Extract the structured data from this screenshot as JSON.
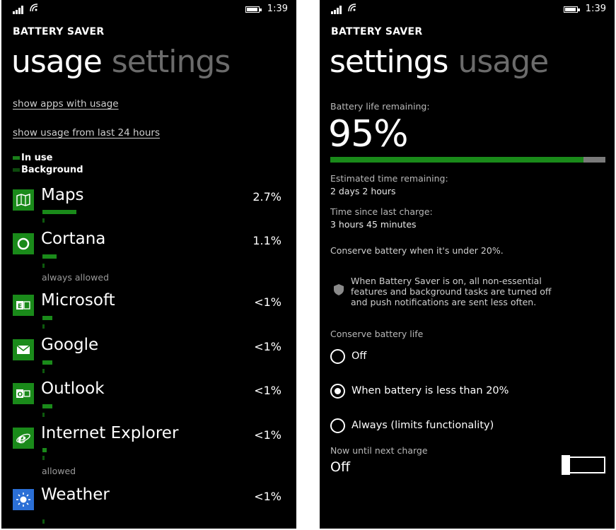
{
  "status": {
    "time": "1:39"
  },
  "left": {
    "app_title": "BATTERY SAVER",
    "pivot": {
      "active": "usage",
      "inactive": "settings"
    },
    "link_apps": "show apps with usage",
    "link_hours": "show usage from last 24 hours",
    "legend": {
      "in_use": "In use",
      "background": "Background"
    },
    "apps": [
      {
        "name": "Maps",
        "pct": "2.7%",
        "icon": "maps-icon",
        "note": "",
        "inuse_fraction": 0.12
      },
      {
        "name": "Cortana",
        "pct": "1.1%",
        "icon": "cortana-icon",
        "note": "always allowed",
        "inuse_fraction": 0.05
      },
      {
        "name": "Microsoft",
        "pct": "<1%",
        "icon": "exchange-icon",
        "note": "",
        "inuse_fraction": 0.035
      },
      {
        "name": "Google",
        "pct": "<1%",
        "icon": "mail-icon",
        "note": "",
        "inuse_fraction": 0.035
      },
      {
        "name": "Outlook",
        "pct": "<1%",
        "icon": "outlook-icon",
        "note": "",
        "inuse_fraction": 0.035
      },
      {
        "name": "Internet Explorer",
        "pct": "<1%",
        "icon": "ie-icon",
        "note": "allowed",
        "inuse_fraction": 0.015
      },
      {
        "name": "Weather",
        "pct": "<1%",
        "icon": "weather-icon",
        "note": "",
        "inuse_fraction": 0.0
      }
    ]
  },
  "right": {
    "app_title": "BATTERY SAVER",
    "pivot": {
      "active": "settings",
      "inactive": "usage"
    },
    "remaining_label": "Battery life remaining:",
    "remaining_pct": "95%",
    "battery_level": 0.95,
    "est_label": "Estimated time remaining:",
    "est_value": "2 days 2 hours",
    "since_label": "Time since last charge:",
    "since_value": "3 hours 45 minutes",
    "conserve_under": "Conserve battery when it's under 20%.",
    "info_line1": "When Battery Saver is on, all non-essential",
    "info_line2": "features and background tasks are turned off",
    "info_line3": "and push notifications are sent less often.",
    "conserve_life_label": "Conserve battery life",
    "options": [
      {
        "label": "Off",
        "selected": false
      },
      {
        "label": "When battery is less than 20%",
        "selected": true
      },
      {
        "label": "Always (limits functionality)",
        "selected": false
      }
    ],
    "until_label": "Now until next charge",
    "until_value": "Off",
    "colors": {
      "accent": "#1a8a1a",
      "track": "#7a7a7a",
      "background": "#000000"
    }
  }
}
